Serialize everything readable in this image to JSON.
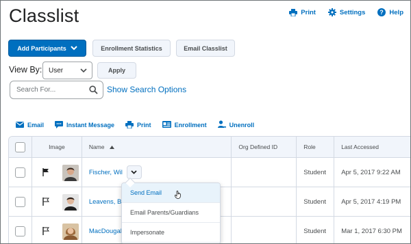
{
  "page": {
    "title": "Classlist"
  },
  "toplinks": {
    "print": "Print",
    "settings": "Settings",
    "help": "Help"
  },
  "buttons": {
    "add_participants": "Add Participants",
    "enrollment_statistics": "Enrollment Statistics",
    "email_classlist": "Email Classlist",
    "apply": "Apply"
  },
  "view_by": {
    "label": "View By:",
    "value": "User"
  },
  "search": {
    "placeholder": "Search For...",
    "options_link": "Show Search Options"
  },
  "actions": {
    "email": "Email",
    "instant_message": "Instant Message",
    "print": "Print",
    "enrollment": "Enrollment",
    "unenroll": "Unenroll"
  },
  "table": {
    "headers": {
      "image": "Image",
      "name": "Name",
      "org_id": "Org Defined ID",
      "role": "Role",
      "last_accessed": "Last Accessed"
    },
    "rows": [
      {
        "name": "Fischer, Wil",
        "org_id": "",
        "role": "Student",
        "last_accessed": "Apr 5, 2017 9:22 AM"
      },
      {
        "name": "Leavens, Ber",
        "org_id": "",
        "role": "Student",
        "last_accessed": "Apr 5, 2017 4:19 PM"
      },
      {
        "name": "MacDougall, L",
        "org_id": "",
        "role": "Student",
        "last_accessed": "Mar 1, 2017 6:30 PM"
      }
    ]
  },
  "context_menu": {
    "items": [
      "Send Email",
      "Email Parents/Guardians",
      "Impersonate"
    ],
    "highlighted": "Send Email"
  },
  "colors": {
    "accent": "#006fbf",
    "secondary_bg": "#f1f5fb",
    "border": "#d3d9e3"
  }
}
